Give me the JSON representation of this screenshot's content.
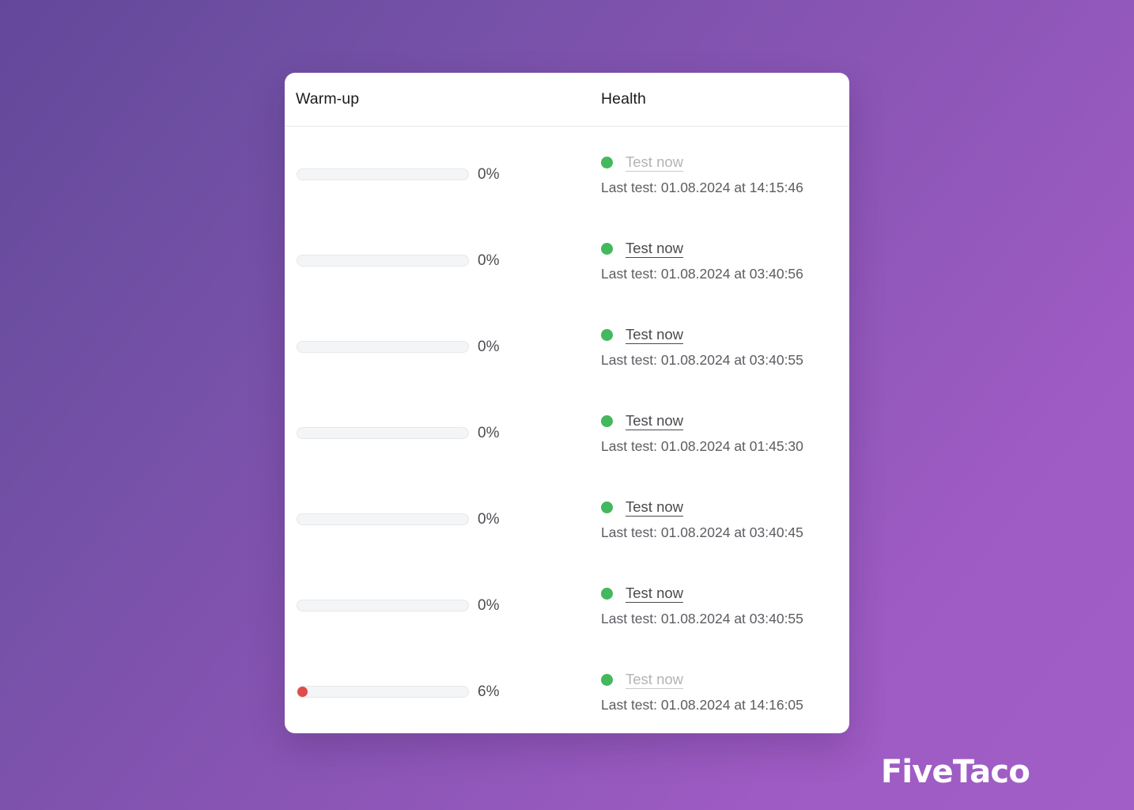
{
  "background": {
    "gradient_from": "#64479a",
    "gradient_to": "#a15ec6"
  },
  "brand": {
    "name": "FiveTaco",
    "color": "#ffffff"
  },
  "card": {
    "columns": {
      "warmup": "Warm-up",
      "health": "Health"
    },
    "colors": {
      "status_ok": "#44b85d",
      "progress_fill": "#e04b4b",
      "track": "#f4f5f7"
    },
    "rows": [
      {
        "warmup_percent_label": "0%",
        "warmup_percent_value": 0,
        "status": "ok",
        "test_label": "Test now",
        "test_enabled": false,
        "last_test": "Last test: 01.08.2024 at 14:15:46"
      },
      {
        "warmup_percent_label": "0%",
        "warmup_percent_value": 0,
        "status": "ok",
        "test_label": "Test now",
        "test_enabled": true,
        "last_test": "Last test: 01.08.2024 at 03:40:56"
      },
      {
        "warmup_percent_label": "0%",
        "warmup_percent_value": 0,
        "status": "ok",
        "test_label": "Test now",
        "test_enabled": true,
        "last_test": "Last test: 01.08.2024 at 03:40:55"
      },
      {
        "warmup_percent_label": "0%",
        "warmup_percent_value": 0,
        "status": "ok",
        "test_label": "Test now",
        "test_enabled": true,
        "last_test": "Last test: 01.08.2024 at 01:45:30"
      },
      {
        "warmup_percent_label": "0%",
        "warmup_percent_value": 0,
        "status": "ok",
        "test_label": "Test now",
        "test_enabled": true,
        "last_test": "Last test: 01.08.2024 at 03:40:45"
      },
      {
        "warmup_percent_label": "0%",
        "warmup_percent_value": 0,
        "status": "ok",
        "test_label": "Test now",
        "test_enabled": true,
        "last_test": "Last test: 01.08.2024 at 03:40:55"
      },
      {
        "warmup_percent_label": "6%",
        "warmup_percent_value": 6,
        "status": "ok",
        "test_label": "Test now",
        "test_enabled": false,
        "last_test": "Last test: 01.08.2024 at 14:16:05"
      }
    ]
  }
}
